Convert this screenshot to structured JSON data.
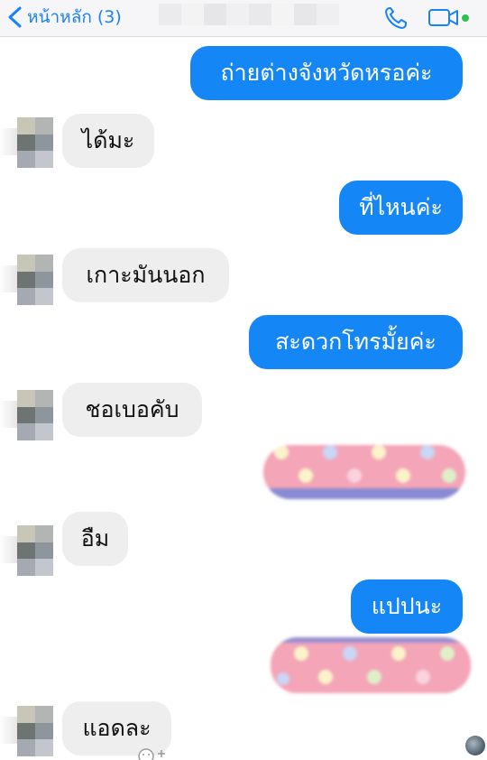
{
  "header": {
    "back_label": "หน้าหลัก (3)",
    "icons": {
      "back": "chevron-left-icon",
      "call": "phone-icon",
      "video": "video-camera-icon"
    },
    "accent_color": "#1a82f5",
    "online_dot_color": "#2fc24a"
  },
  "messages": [
    {
      "side": "out",
      "text": "ถ่ายต่างจังหวัดหรอค่ะ"
    },
    {
      "side": "in",
      "text": "ได้มะ"
    },
    {
      "side": "out",
      "text": "ที่ไหนค่ะ"
    },
    {
      "side": "in",
      "text": "เกาะมันนอก"
    },
    {
      "side": "out",
      "text": "สะดวกโทรมั้ยค่ะ"
    },
    {
      "side": "in",
      "text": "ชอเบอคับ"
    },
    {
      "side": "out",
      "type": "sticker"
    },
    {
      "side": "in",
      "text": "อืม"
    },
    {
      "side": "out",
      "text": "แปปนะ"
    },
    {
      "side": "out",
      "type": "sticker"
    },
    {
      "side": "in",
      "text": "แอดละ"
    }
  ],
  "colors": {
    "outgoing_bubble": "#1486f6",
    "incoming_bubble": "#eeeeef"
  }
}
